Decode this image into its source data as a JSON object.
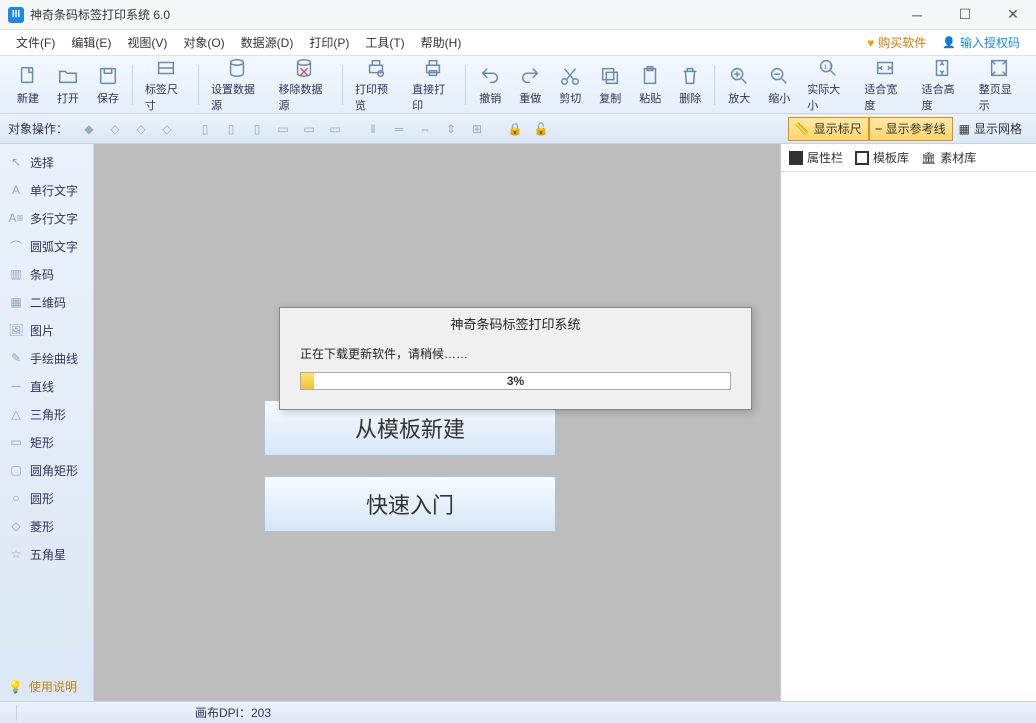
{
  "title": "神奇条码标签打印系统 6.0",
  "menu": [
    "文件(F)",
    "编辑(E)",
    "视图(V)",
    "对象(O)",
    "数据源(D)",
    "打印(P)",
    "工具(T)",
    "帮助(H)"
  ],
  "menu_right": {
    "buy": "购买软件",
    "auth": "输入授权码"
  },
  "toolbar1": [
    "新建",
    "打开",
    "保存",
    "标签尺寸",
    "设置数据源",
    "移除数据源",
    "打印预览",
    "直接打印",
    "撤销",
    "重做",
    "剪切",
    "复制",
    "粘贴",
    "删除",
    "放大",
    "缩小",
    "实际大小",
    "适合宽度",
    "适合高度",
    "整页显示"
  ],
  "toolbar2": {
    "label": "对象操作：",
    "ruler": "显示标尺",
    "guides": "显示参考线",
    "grid": "显示网格"
  },
  "left_tools": [
    "选择",
    "单行文字",
    "多行文字",
    "圆弧文字",
    "条码",
    "二维码",
    "图片",
    "手绘曲线",
    "直线",
    "三角形",
    "矩形",
    "圆角矩形",
    "圆形",
    "菱形",
    "五角星"
  ],
  "help_label": "使用说明",
  "canvas_buttons": {
    "template": "从模板新建",
    "quickstart": "快速入门"
  },
  "right_tabs": [
    "属性栏",
    "模板库",
    "素材库"
  ],
  "status": {
    "dpi": "画布DPI：203"
  },
  "dialog": {
    "title": "神奇条码标签打印系统",
    "message": "正在下载更新软件，请稍候……",
    "progress_text": "3%",
    "progress_value": 3
  }
}
